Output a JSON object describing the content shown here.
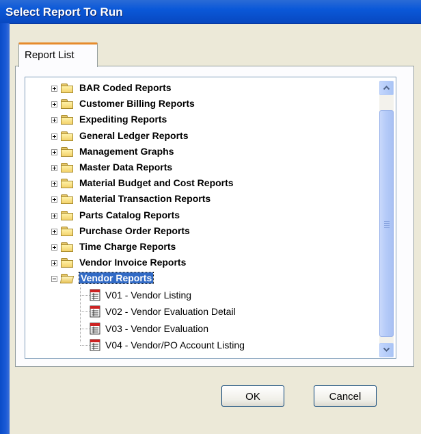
{
  "window": {
    "title": "Select Report To Run"
  },
  "tabs": [
    {
      "label": "Report List"
    }
  ],
  "tree": {
    "folders": [
      {
        "label": "BAR Coded Reports",
        "expanded": false
      },
      {
        "label": "Customer Billing Reports",
        "expanded": false
      },
      {
        "label": "Expediting Reports",
        "expanded": false
      },
      {
        "label": "General Ledger Reports",
        "expanded": false
      },
      {
        "label": "Management Graphs",
        "expanded": false
      },
      {
        "label": "Master Data Reports",
        "expanded": false
      },
      {
        "label": "Material Budget and Cost Reports",
        "expanded": false
      },
      {
        "label": "Material Transaction Reports",
        "expanded": false
      },
      {
        "label": "Parts Catalog Reports",
        "expanded": false
      },
      {
        "label": "Purchase Order Reports",
        "expanded": false
      },
      {
        "label": "Time Charge Reports",
        "expanded": false
      },
      {
        "label": "Vendor Invoice Reports",
        "expanded": false
      },
      {
        "label": "Vendor Reports",
        "expanded": true,
        "selected": true
      }
    ],
    "reports": [
      {
        "label": "V01 - Vendor Listing"
      },
      {
        "label": "V02 - Vendor Evaluation Detail"
      },
      {
        "label": "V03 - Vendor Evaluation"
      },
      {
        "label": "V04 - Vendor/PO Account Listing"
      }
    ]
  },
  "buttons": {
    "ok": "OK",
    "cancel": "Cancel"
  },
  "colors": {
    "selection": "#316ac5",
    "titlebar": "#0a58d8",
    "tab_accent": "#e68b2c"
  }
}
